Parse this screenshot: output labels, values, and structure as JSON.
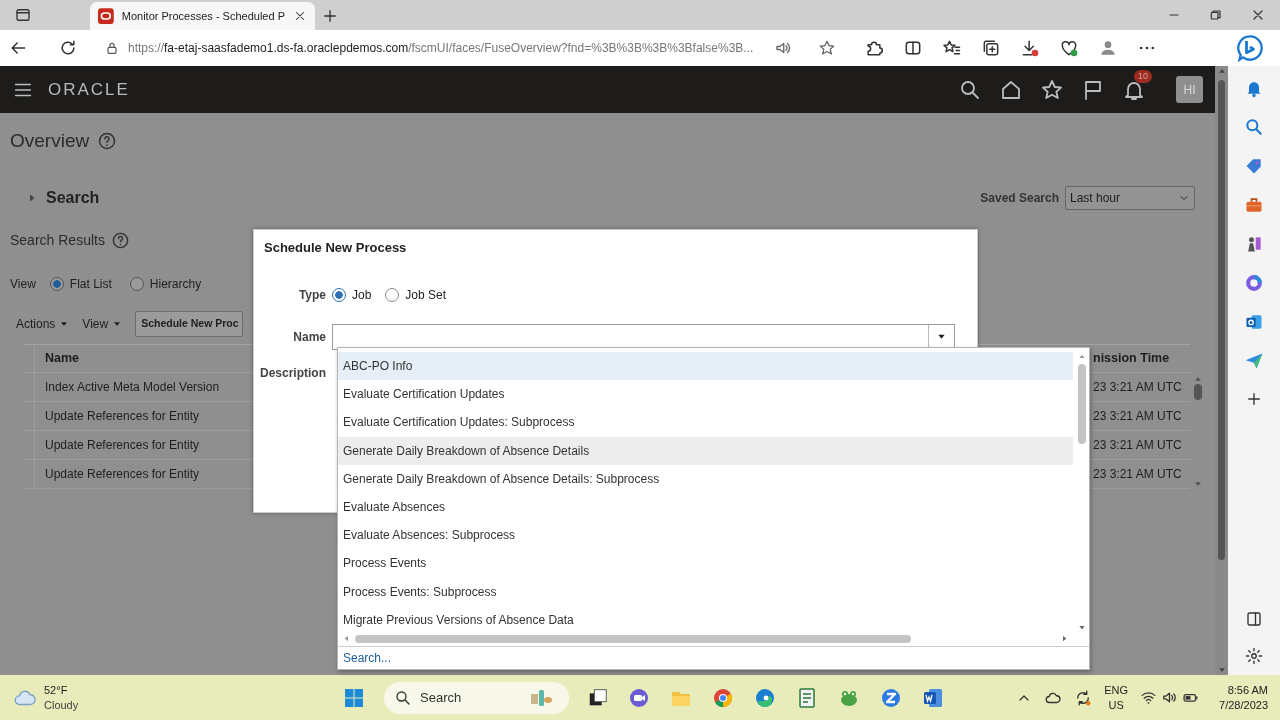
{
  "browser": {
    "tab_title": "Monitor Processes - Scheduled P",
    "url_scheme": "https://",
    "url_host": "fa-etaj-saasfademo1.ds-fa.oraclepdemos.com",
    "url_path": "/fscmUI/faces/FuseOverview?fnd=%3B%3B%3B%3Bfalse%3B..."
  },
  "app": {
    "logo": "ORACLE",
    "notification_count": "10",
    "user_initials": "HI"
  },
  "page": {
    "title": "Overview",
    "search_label": "Search",
    "search_expanded": false,
    "saved_search_label": "Saved Search",
    "saved_search_value": "Last hour",
    "results_title": "Search Results",
    "view_label": "View",
    "view_options": [
      {
        "label": "Flat List",
        "selected": true
      },
      {
        "label": "Hierarchy",
        "selected": false
      }
    ],
    "toolbar": [
      {
        "label": "Actions",
        "kind": "menu"
      },
      {
        "label": "View",
        "kind": "menu"
      },
      {
        "label": "Schedule New Proc",
        "kind": "button"
      }
    ],
    "table": {
      "columns": [
        "Name",
        "nission Time"
      ],
      "rows": [
        [
          "Index Active Meta Model Version",
          "23 3:21 AM UTC"
        ],
        [
          "Update References for Entity",
          "23 3:21 AM UTC"
        ],
        [
          "Update References for Entity",
          "23 3:21 AM UTC"
        ],
        [
          "Update References for Entity",
          "23 3:21 AM UTC"
        ]
      ]
    }
  },
  "dialog": {
    "title": "Schedule New Process",
    "type_label": "Type",
    "type_options": [
      {
        "label": "Job",
        "selected": true
      },
      {
        "label": "Job Set",
        "selected": false
      }
    ],
    "name_label": "Name",
    "description_label": "Description"
  },
  "dropdown": {
    "items": [
      {
        "label": "ABC-PO Info",
        "selected": true,
        "hovered": false
      },
      {
        "label": "Evaluate Certification Updates",
        "selected": false,
        "hovered": false
      },
      {
        "label": "Evaluate Certification Updates: Subprocess",
        "selected": false,
        "hovered": false
      },
      {
        "label": "Generate Daily Breakdown of Absence Details",
        "selected": false,
        "hovered": true
      },
      {
        "label": "Generate Daily Breakdown of Absence Details: Subprocess",
        "selected": false,
        "hovered": false
      },
      {
        "label": "Evaluate Absences",
        "selected": false,
        "hovered": false
      },
      {
        "label": "Evaluate Absences: Subprocess",
        "selected": false,
        "hovered": false
      },
      {
        "label": "Process Events",
        "selected": false,
        "hovered": false
      },
      {
        "label": "Process Events: Subprocess",
        "selected": false,
        "hovered": false
      },
      {
        "label": "Migrate Previous Versions of Absence Data",
        "selected": false,
        "hovered": false
      }
    ],
    "search_link": "Search..."
  },
  "taskbar": {
    "temperature": "52°F",
    "condition": "Cloudy",
    "search_placeholder": "Search",
    "language": "ENG",
    "region": "US",
    "time": "8:56 AM",
    "date": "7/28/2023"
  }
}
